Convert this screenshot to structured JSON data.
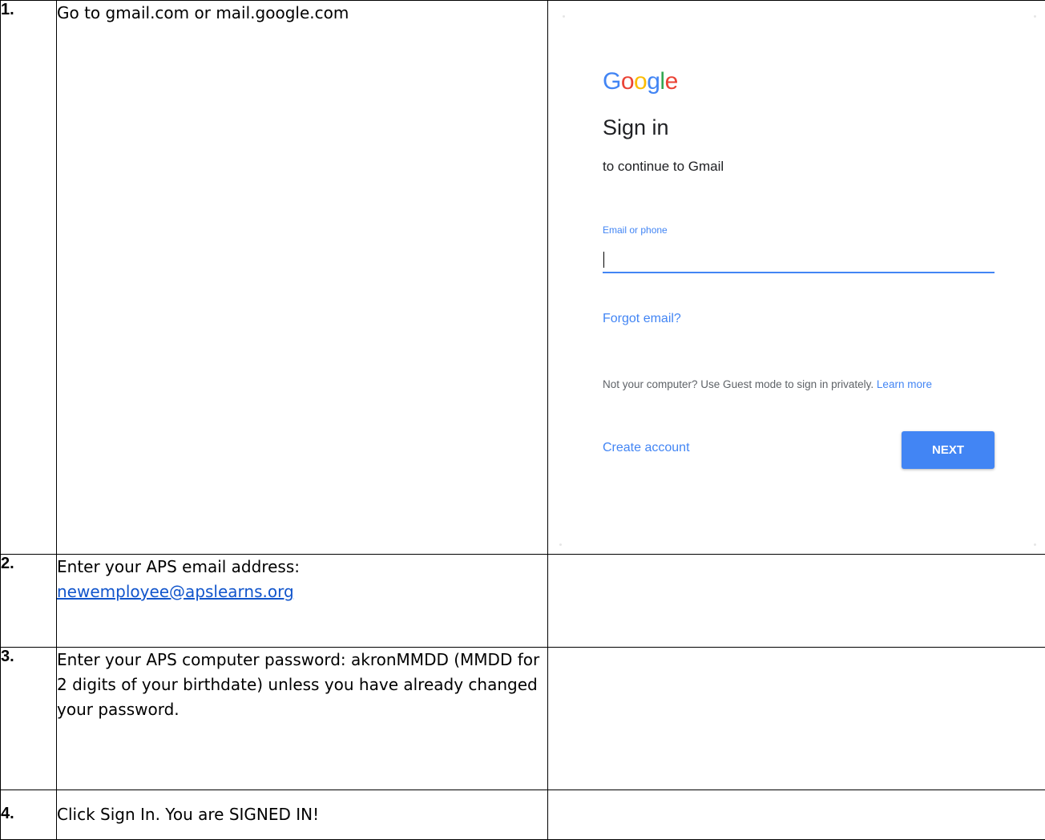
{
  "steps": [
    {
      "number": "1.",
      "text": "Go to gmail.com or mail.google.com"
    },
    {
      "number": "2.",
      "text": "Enter your APS email address:",
      "link": "newemployee@apslearns.org"
    },
    {
      "number": "3.",
      "text": "Enter your APS computer password: akronMMDD (MMDD for 2 digits of your birthdate) unless you have already changed your password."
    },
    {
      "number": "4.",
      "text": "Click Sign In. You are SIGNED IN!"
    }
  ],
  "signin": {
    "logo_letters": [
      "G",
      "o",
      "o",
      "g",
      "l",
      "e"
    ],
    "logo_colors": [
      "#4285f4",
      "#ea4335",
      "#fbbc05",
      "#4285f4",
      "#34a853",
      "#ea4335"
    ],
    "title": "Sign in",
    "subtitle": "to continue to Gmail",
    "email_label": "Email or phone",
    "email_value": "",
    "forgot_email": "Forgot email?",
    "guest_note": "Not your computer? Use Guest mode to sign in privately.",
    "learn_more": "Learn more",
    "create_account": "Create account",
    "next_button": "NEXT",
    "accent_color": "#4285f4"
  }
}
